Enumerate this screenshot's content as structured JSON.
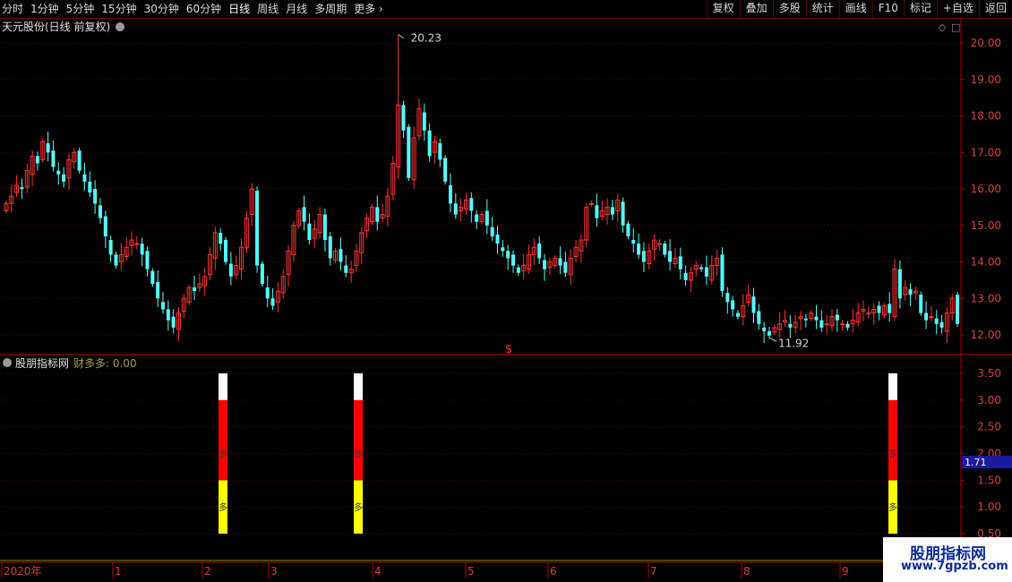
{
  "toolbar": {
    "left_items": [
      "分时",
      "1分钟",
      "5分钟",
      "15分钟",
      "30分钟",
      "60分钟",
      "日线",
      "周线",
      "月线",
      "多周期",
      "更多 ›"
    ],
    "active_item": "日线",
    "right_items": [
      "复权",
      "叠加",
      "多股",
      "统计",
      "画线",
      "F10",
      "标记",
      "+自选",
      "返回"
    ]
  },
  "colors": {
    "up": "#ff3232",
    "down": "#54ffff",
    "axis": "#b00000",
    "grid": "#5a0000",
    "indicator_top": "#ffffff",
    "indicator_mid": "#ff0000",
    "indicator_low": "#ffff00",
    "value_box": "#1a1a9a"
  },
  "main_panel": {
    "title": "天元股份(日线 前复权)",
    "collapse_icon": "chevron-down-circle-icon",
    "high_label": "20.23",
    "low_label": "11.92",
    "marker_text": "$"
  },
  "indicator_panel": {
    "title": "股朋指标网",
    "subtitle": "财多多: 0.00",
    "value_box": "1.71",
    "bar_char": "多"
  },
  "watermark": {
    "line1": "股朋指标网",
    "line2": "www.7gpzb.com"
  },
  "chart_data": [
    {
      "type": "candlestick",
      "title": "天元股份(日线 前复权)",
      "yaxis_ticks": [
        "12.00",
        "13.00",
        "14.00",
        "15.00",
        "16.00",
        "17.00",
        "18.00",
        "19.00",
        "20.00"
      ],
      "ylim": [
        11.7,
        20.6
      ],
      "xaxis_labels": [
        "2020年",
        "1",
        "2",
        "3",
        "4",
        "5",
        "6",
        "7",
        "8",
        "9"
      ],
      "annotations": [
        {
          "text": "20.23",
          "value": 20.23
        },
        {
          "text": "11.92",
          "value": 11.92
        }
      ],
      "close_series": [
        15.6,
        15.8,
        16.1,
        16.0,
        16.5,
        16.9,
        16.7,
        17.3,
        17.0,
        16.6,
        16.4,
        16.2,
        16.8,
        17.0,
        16.5,
        16.2,
        15.9,
        15.6,
        15.2,
        14.7,
        14.2,
        13.9,
        14.2,
        14.4,
        14.6,
        14.5,
        14.2,
        13.8,
        13.4,
        13.0,
        12.7,
        12.4,
        12.2,
        12.6,
        13.0,
        13.3,
        13.2,
        13.4,
        13.6,
        14.2,
        14.8,
        14.5,
        14.0,
        13.6,
        13.9,
        14.4,
        15.2,
        16.0,
        13.9,
        13.4,
        13.0,
        12.8,
        13.2,
        13.6,
        14.3,
        15.0,
        15.4,
        15.1,
        14.6,
        14.9,
        15.3,
        14.6,
        14.1,
        14.3,
        14.0,
        13.7,
        13.8,
        14.3,
        14.8,
        15.2,
        15.5,
        15.1,
        15.3,
        15.8,
        16.7,
        18.3,
        17.6,
        16.3,
        17.4,
        18.2,
        17.6,
        16.9,
        17.3,
        16.8,
        16.2,
        15.6,
        15.3,
        15.5,
        15.7,
        15.4,
        15.1,
        15.3,
        15.0,
        14.7,
        14.5,
        14.3,
        14.1,
        13.9,
        13.7,
        13.9,
        14.2,
        14.4,
        14.1,
        13.8,
        14.0,
        14.1,
        13.9,
        13.7,
        14.1,
        14.4,
        14.6,
        15.5,
        15.6,
        15.2,
        15.4,
        15.5,
        15.3,
        15.7,
        15.0,
        14.7,
        14.5,
        14.2,
        14.0,
        14.3,
        14.6,
        14.5,
        14.2,
        14.0,
        14.1,
        13.8,
        13.5,
        13.7,
        13.9,
        13.8,
        13.6,
        13.9,
        14.1,
        13.2,
        12.9,
        12.7,
        12.5,
        12.8,
        13.1,
        12.6,
        12.3,
        12.1,
        11.98,
        12.2,
        12.3,
        12.4,
        12.2,
        12.35,
        12.5,
        12.4,
        12.6,
        12.4,
        12.2,
        12.3,
        12.5,
        12.4,
        12.3,
        12.2,
        12.4,
        12.6,
        12.7,
        12.6,
        12.7,
        12.6,
        12.8,
        12.6,
        13.8,
        13.0,
        13.3,
        13.1,
        13.2,
        12.6,
        12.4,
        12.5,
        12.3,
        12.2,
        12.6,
        13.0,
        12.3
      ],
      "series": [
        {
          "name": "财多多",
          "values": [
            0.0
          ]
        }
      ]
    },
    {
      "type": "bar",
      "title": "股朋指标网",
      "yaxis_ticks": [
        "0.50",
        "1.00",
        "1.50",
        "2.00",
        "2.50",
        "3.00",
        "3.50"
      ],
      "ylim": [
        0.45,
        3.75
      ],
      "signals": [
        {
          "segments": [
            {
              "from": 0.5,
              "to": 1.5
            },
            {
              "from": 1.5,
              "to": 3.0
            },
            {
              "from": 3.0,
              "to": 3.5
            }
          ]
        },
        {
          "segments": [
            {
              "from": 0.5,
              "to": 1.5
            },
            {
              "from": 1.5,
              "to": 3.0
            },
            {
              "from": 3.0,
              "to": 3.5
            }
          ]
        },
        {
          "segments": [
            {
              "from": 0.5,
              "to": 1.5
            },
            {
              "from": 1.5,
              "to": 3.0
            },
            {
              "from": 3.0,
              "to": 3.5
            }
          ]
        }
      ]
    }
  ]
}
